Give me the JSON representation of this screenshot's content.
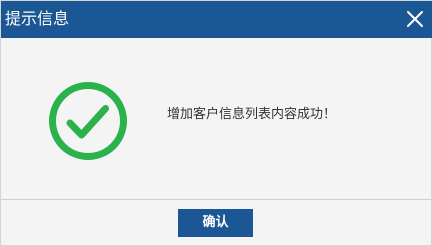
{
  "dialog": {
    "title": "提示信息",
    "close_icon": "close-icon",
    "message": "增加客户信息列表内容成功！",
    "status_icon": "check-circle-icon",
    "ok_label": "确认"
  },
  "colors": {
    "titlebar_bg": "#1c5795",
    "title_text": "#ffffff",
    "body_bg": "#f4f4f4",
    "success_green": "#2bb24c",
    "button_bg": "#1c5795",
    "message_text": "#333333"
  }
}
